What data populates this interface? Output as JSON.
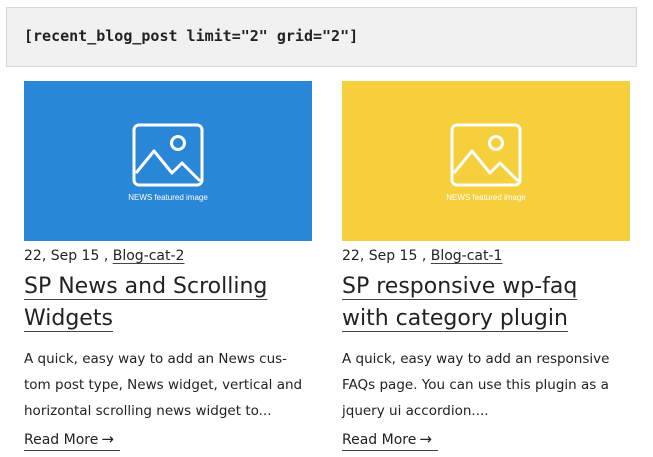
{
  "shortcode": {
    "text": "[recent_blog_post limit=\"2\" grid=\"2\"]"
  },
  "posts": [
    {
      "image_caption": "NEWS featured image",
      "image_color": "#2a87d8",
      "date": "22, Sep 15 , ",
      "category": "Blog-cat-2",
      "title": "SP News and Scrolling Widgets",
      "excerpt": "A quick, easy way to add an News cus-tom post type, News widget, vertical and horizontal scrolling news widget to...",
      "read_more": "Read More",
      "arrow_icon": "arrow-right-icon"
    },
    {
      "image_caption": "NEWS featured image",
      "image_color": "#f6cf3c",
      "date": "22, Sep 15 , ",
      "category": "Blog-cat-1",
      "title": "SP responsive wp-faq with category plugin",
      "excerpt": "A quick, easy way to add an responsive FAQs page. You can use this plugin as a jquery ui accordion....",
      "read_more": "Read More",
      "arrow_icon": "arrow-right-icon"
    }
  ]
}
